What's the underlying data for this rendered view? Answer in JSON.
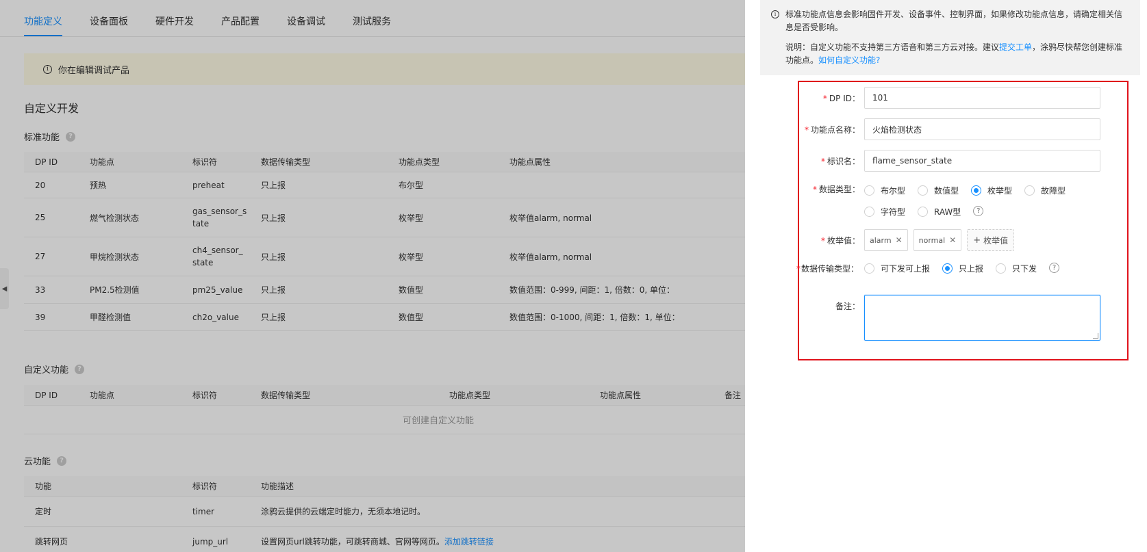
{
  "tabs": [
    {
      "label": "功能定义",
      "active": true
    },
    {
      "label": "设备面板",
      "active": false
    },
    {
      "label": "硬件开发",
      "active": false
    },
    {
      "label": "产品配置",
      "active": false
    },
    {
      "label": "设备调试",
      "active": false
    },
    {
      "label": "测试服务",
      "active": false
    }
  ],
  "notice": {
    "text": "你在编辑调试产品"
  },
  "page_title": "自定义开发",
  "standard": {
    "title": "标准功能",
    "headers": [
      "DP ID",
      "功能点",
      "标识符",
      "数据传输类型",
      "功能点类型",
      "功能点属性"
    ],
    "rows": [
      {
        "id": "20",
        "name": "预热",
        "code": "preheat",
        "trans": "只上报",
        "type": "布尔型",
        "attr": ""
      },
      {
        "id": "25",
        "name": "燃气检测状态",
        "code": "gas_sensor_state",
        "code_l1": "gas_sensor_s",
        "code_l2": "tate",
        "trans": "只上报",
        "type": "枚举型",
        "attr": "枚举值alarm, normal"
      },
      {
        "id": "27",
        "name": "甲烷检测状态",
        "code": "ch4_sensor_state",
        "code_l1": "ch4_sensor_",
        "code_l2": "state",
        "trans": "只上报",
        "type": "枚举型",
        "attr": "枚举值alarm, normal"
      },
      {
        "id": "33",
        "name": "PM2.5检测值",
        "code": "pm25_value",
        "trans": "只上报",
        "type": "数值型",
        "attr": "数值范围：0-999, 间距：1, 倍数：0, 单位："
      },
      {
        "id": "39",
        "name": "甲醛检测值",
        "code": "ch2o_value",
        "trans": "只上报",
        "type": "数值型",
        "attr": "数值范围：0-1000, 间距：1, 倍数：1, 单位："
      }
    ]
  },
  "custom": {
    "title": "自定义功能",
    "headers": [
      "DP ID",
      "功能点",
      "标识符",
      "数据传输类型",
      "功能点类型",
      "功能点属性",
      "备注"
    ],
    "empty_text": "可创建自定义功能"
  },
  "cloud": {
    "title": "云功能",
    "headers": [
      "功能",
      "标识符",
      "功能描述"
    ],
    "rows": [
      {
        "name": "定时",
        "code": "timer",
        "desc": "涂鸦云提供的云端定时能力，无须本地记时。",
        "link": ""
      },
      {
        "name": "跳转网页",
        "code": "jump_url",
        "desc": "设置网页url跳转功能，可跳转商城、官网等网页。",
        "link": "添加跳转链接"
      }
    ]
  },
  "drawer": {
    "info_line1": "标准功能点信息会影响固件开发、设备事件、控制界面，如果修改功能点信息，请确定相关信息是否受影响。",
    "info_line2_prefix": "说明：自定义功能不支持第三方语音和第三方云对接。建议",
    "info_link1": "提交工单",
    "info_line2_mid": "，涂鸦尽快帮您创建标准功能点。",
    "info_link2": "如何自定义功能?",
    "form": {
      "dpid_label": "DP ID",
      "dpid_value": "101",
      "name_label": "功能点名称",
      "name_value": "火焰检测状态",
      "code_label": "标识名",
      "code_value": "flame_sensor_state",
      "datatype_label": "数据类型",
      "datatypes": [
        {
          "label": "布尔型",
          "checked": false
        },
        {
          "label": "数值型",
          "checked": false
        },
        {
          "label": "枚举型",
          "checked": true
        },
        {
          "label": "故障型",
          "checked": false
        },
        {
          "label": "字符型",
          "checked": false
        },
        {
          "label": "RAW型",
          "checked": false
        }
      ],
      "enum_label": "枚举值",
      "enum_tags": [
        "alarm",
        "normal"
      ],
      "enum_add": "枚举值",
      "trans_label": "数据传输类型",
      "trans_options": [
        {
          "label": "可下发可上报",
          "checked": false
        },
        {
          "label": "只上报",
          "checked": true
        },
        {
          "label": "只下发",
          "checked": false
        }
      ],
      "note_label": "备注",
      "note_value": ""
    }
  },
  "colors": {
    "accent": "#1890ff",
    "highlight_border": "#e0121b",
    "notice_bg": "#fffbe6"
  }
}
